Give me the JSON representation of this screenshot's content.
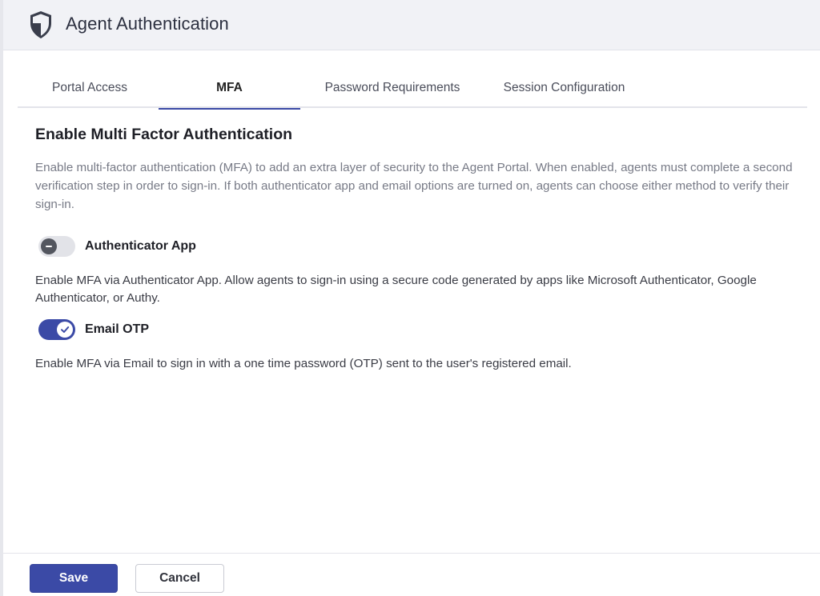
{
  "header": {
    "title": "Agent Authentication",
    "icon": "shield-icon"
  },
  "tabs": [
    {
      "label": "Portal Access",
      "active": false
    },
    {
      "label": "MFA",
      "active": true
    },
    {
      "label": "Password Requirements",
      "active": false
    },
    {
      "label": "Session Configuration",
      "active": false
    }
  ],
  "mfa": {
    "title": "Enable Multi Factor Authentication",
    "description": "Enable multi-factor authentication (MFA) to add an extra layer of security to the Agent Portal. When enabled, agents must complete a second verification step in order to sign-in. If both authenticator app and email options are turned on, agents can choose either method to verify their sign-in.",
    "options": [
      {
        "label": "Authenticator App",
        "enabled": false,
        "help": "Enable MFA via Authenticator App. Allow agents to sign-in using a secure code generated by apps like Microsoft Authenticator, Google Authenticator, or Authy."
      },
      {
        "label": "Email OTP",
        "enabled": true,
        "help": "Enable MFA via Email to sign in with a one time password (OTP) sent to the user's registered email."
      }
    ]
  },
  "footer": {
    "save_label": "Save",
    "cancel_label": "Cancel"
  },
  "colors": {
    "accent": "#3b4aa6",
    "header_bg": "#f1f2f6",
    "toggle_off": "#e2e3e8"
  }
}
